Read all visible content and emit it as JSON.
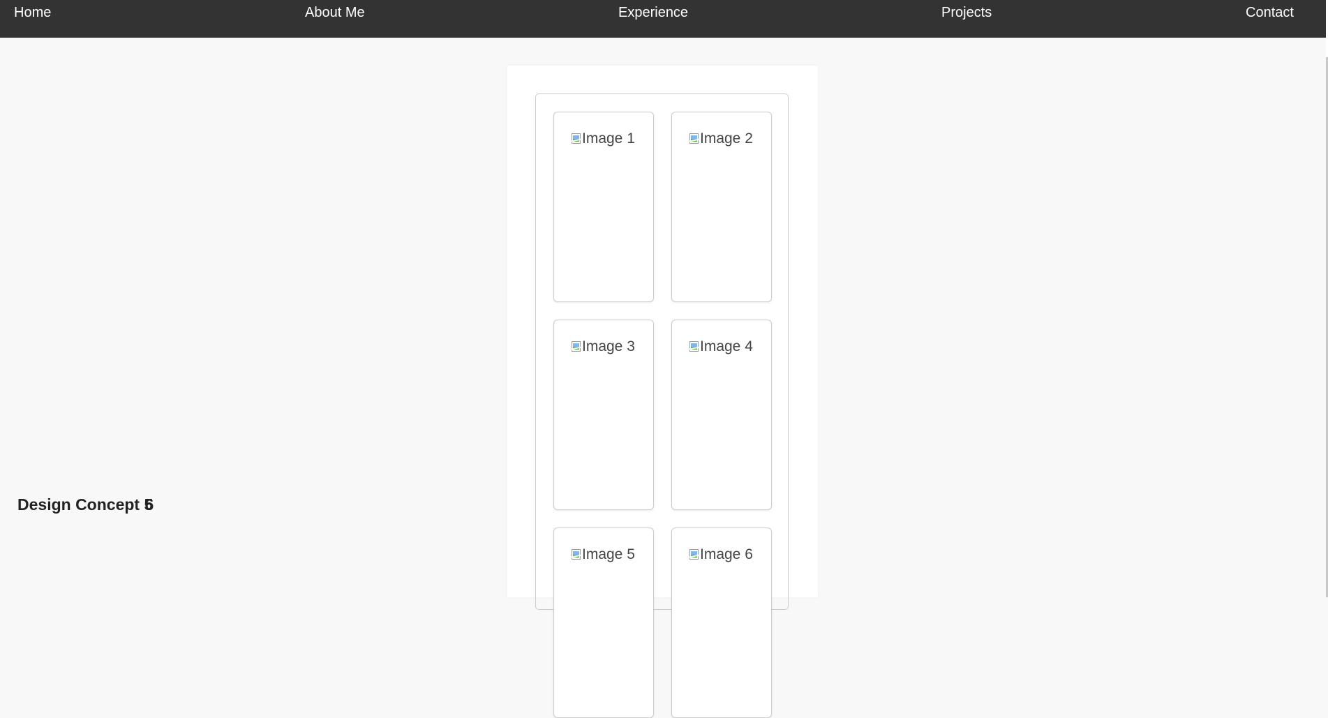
{
  "nav": {
    "items": [
      {
        "label": "Home"
      },
      {
        "label": "About Me"
      },
      {
        "label": "Experience"
      },
      {
        "label": "Projects"
      },
      {
        "label": "Contact"
      }
    ]
  },
  "side": {
    "heading_prefix": "Design Concept",
    "overlap_digit_a": "5",
    "overlap_digit_b": "6"
  },
  "gallery": {
    "images": [
      {
        "alt": "Image 1"
      },
      {
        "alt": "Image 2"
      },
      {
        "alt": "Image 3"
      },
      {
        "alt": "Image 4"
      },
      {
        "alt": "Image 5"
      },
      {
        "alt": "Image 6"
      }
    ]
  },
  "colors": {
    "navbar_bg": "#333333",
    "page_bg": "#f8f8f8",
    "nav_text": "#ffffff"
  }
}
